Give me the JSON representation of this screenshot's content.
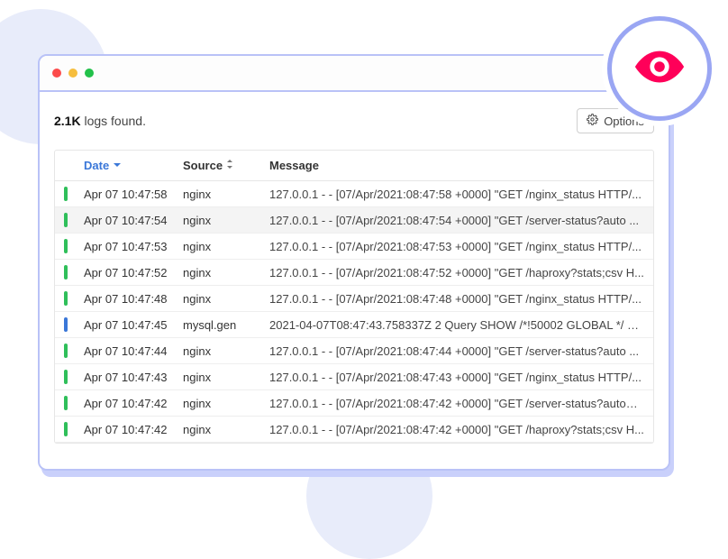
{
  "summary": {
    "count": "2.1K",
    "label": " logs found."
  },
  "options_button": {
    "label": "Options"
  },
  "table": {
    "headers": {
      "date": "Date",
      "source": "Source",
      "message": "Message"
    },
    "rows": [
      {
        "status": "green",
        "hovered": false,
        "date": "Apr 07 10:47:58",
        "source": "nginx",
        "message": "127.0.0.1 - - [07/Apr/2021:08:47:58 +0000] \"GET /nginx_status HTTP/..."
      },
      {
        "status": "green",
        "hovered": true,
        "date": "Apr 07 10:47:54",
        "source": "nginx",
        "message": "127.0.0.1 - - [07/Apr/2021:08:47:54 +0000] \"GET /server-status?auto ..."
      },
      {
        "status": "green",
        "hovered": false,
        "date": "Apr 07 10:47:53",
        "source": "nginx",
        "message": "127.0.0.1 - - [07/Apr/2021:08:47:53 +0000] \"GET /nginx_status HTTP/..."
      },
      {
        "status": "green",
        "hovered": false,
        "date": "Apr 07 10:47:52",
        "source": "nginx",
        "message": "127.0.0.1 - - [07/Apr/2021:08:47:52 +0000] \"GET /haproxy?stats;csv H..."
      },
      {
        "status": "green",
        "hovered": false,
        "date": "Apr 07 10:47:48",
        "source": "nginx",
        "message": "127.0.0.1 - - [07/Apr/2021:08:47:48 +0000] \"GET /nginx_status HTTP/..."
      },
      {
        "status": "blue",
        "hovered": false,
        "date": "Apr 07 10:47:45",
        "source": "mysql.gen",
        "message": "2021-04-07T08:47:43.758337Z 2 Query SHOW /*!50002 GLOBAL */ S..."
      },
      {
        "status": "green",
        "hovered": false,
        "date": "Apr 07 10:47:44",
        "source": "nginx",
        "message": "127.0.0.1 - - [07/Apr/2021:08:47:44 +0000] \"GET /server-status?auto ..."
      },
      {
        "status": "green",
        "hovered": false,
        "date": "Apr 07 10:47:43",
        "source": "nginx",
        "message": "127.0.0.1 - - [07/Apr/2021:08:47:43 +0000] \"GET /nginx_status HTTP/..."
      },
      {
        "status": "green",
        "hovered": false,
        "date": "Apr 07 10:47:42",
        "source": "nginx",
        "message": "127.0.0.1 - - [07/Apr/2021:08:47:42 +0000] \"GET /server-status?auto= ..."
      },
      {
        "status": "green",
        "hovered": false,
        "date": "Apr 07 10:47:42",
        "source": "nginx",
        "message": "127.0.0.1 - - [07/Apr/2021:08:47:42 +0000] \"GET /haproxy?stats;csv H..."
      }
    ]
  }
}
